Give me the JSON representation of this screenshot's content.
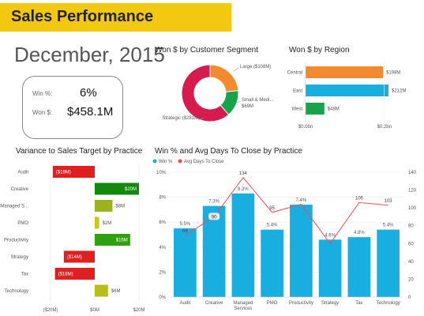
{
  "header": {
    "title": "Sales Performance",
    "date": "December, 2015"
  },
  "kpi": {
    "win_pct_label": "Win %:",
    "win_pct_value": "6%",
    "won_label": "Won $:",
    "won_value": "$458.1M"
  },
  "colors": {
    "title_bar": "#f2c811",
    "orange": "#f28a30",
    "cyan": "#19aee0",
    "green": "#16a34a",
    "dark_green": "#138a0e",
    "olive": "#9bb31a",
    "red": "#e02020",
    "crimson": "#d81b4e",
    "line_red": "#f04e4e"
  },
  "chart_data": [
    {
      "type": "pie",
      "title": "Won $ by Customer Segment",
      "categories": [
        "Large ($108M)",
        "Small & Medi... $69M",
        "Strategic ($281M)"
      ],
      "values": [
        108,
        69,
        281
      ],
      "colors": [
        "#f28a30",
        "#16a34a",
        "#d81b4e"
      ],
      "donut": true
    },
    {
      "type": "bar",
      "orientation": "horizontal",
      "title": "Won $ by Region",
      "categories": [
        "Central",
        "East",
        "West"
      ],
      "values": [
        198,
        212,
        48
      ],
      "data_labels": [
        "$198M",
        "$212M",
        "$48M"
      ],
      "colors": [
        "#f28a30",
        "#19aee0",
        "#16a34a"
      ],
      "xlim": [
        0,
        212
      ],
      "x_ticks": [
        "$0.0bn",
        "$0.2bn"
      ]
    },
    {
      "type": "bar",
      "orientation": "horizontal",
      "title": "Variance to Sales Target by Practice",
      "categories": [
        "Audit",
        "Creative",
        "Managed S...",
        "PMO",
        "Productivity",
        "Strategy",
        "Tax",
        "Technology"
      ],
      "values": [
        -19,
        20,
        8,
        2,
        16,
        -14,
        -18,
        6
      ],
      "data_labels": [
        "($19M)",
        "$20M",
        "$8M",
        "$2M",
        "$16M",
        "($14M)",
        "($18M)",
        "$6M"
      ],
      "colors": [
        "#e02020",
        "#138a0e",
        "#9bb31a",
        "#c4cc1a",
        "#30a010",
        "#e02020",
        "#e02020",
        "#b8bd16"
      ],
      "xlim": [
        -20,
        20
      ],
      "x_ticks": [
        "($20M)",
        "$0M",
        "$20M"
      ]
    },
    {
      "type": "bar",
      "title": "Win % and Avg Days To Close by Practice",
      "legend": [
        "Win %",
        "Avg Days To Close"
      ],
      "legend_placement": "top-left",
      "categories": [
        "Audit",
        "Creative",
        "Managed Services",
        "PMO",
        "Productivity",
        "Strategy",
        "Tax",
        "Technology"
      ],
      "series": [
        {
          "name": "Win %",
          "type": "bar",
          "values": [
            5.5,
            7.3,
            8.3,
            5.4,
            7.4,
            4.6,
            4.8,
            5.4
          ],
          "labels": [
            "5.5%",
            "7.3%",
            "8.3%",
            "5.4%",
            "7.4%",
            "4.6%",
            "4.8%",
            "5.4%"
          ],
          "color": "#19aee0"
        },
        {
          "name": "Avg Days To Close",
          "type": "line",
          "values": [
            69,
            90,
            134,
            95,
            104,
            60,
            106,
            103
          ],
          "labels": [
            "69",
            "90",
            "134",
            "95",
            "",
            "",
            "106",
            "103"
          ],
          "color": "#f04e4e"
        }
      ],
      "y_left": {
        "ylim": [
          0,
          10
        ],
        "ticks": [
          "0%",
          "2%",
          "4%",
          "6%",
          "8%",
          "10%"
        ]
      },
      "y_right": {
        "ylim": [
          0,
          140
        ],
        "ticks": [
          "0",
          "20",
          "40",
          "60",
          "80",
          "100",
          "120",
          "140"
        ]
      }
    }
  ]
}
